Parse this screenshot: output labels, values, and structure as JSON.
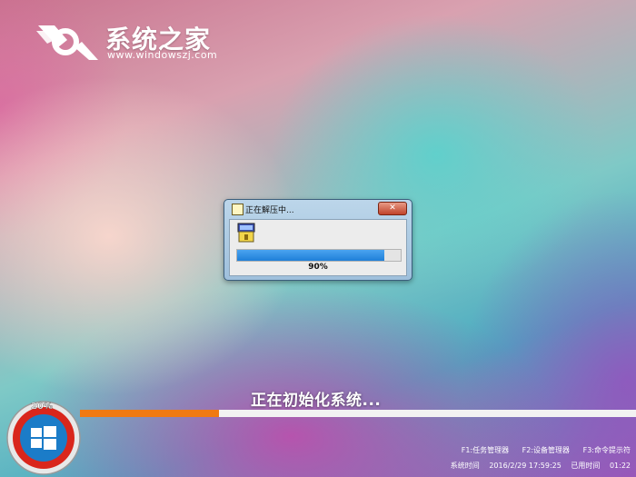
{
  "brand": {
    "title": "系统之家",
    "url": "www.windowszj.com"
  },
  "dialog": {
    "title": "正在解压中...",
    "close_label": "✕",
    "progress_percent": 90,
    "progress_label": "90%"
  },
  "status": {
    "text": "正在初始化系统..."
  },
  "installer": {
    "overall_percent": 20,
    "overall_label": "20%",
    "overall_bar_fraction": 0.25
  },
  "footer": {
    "f1": "F1:任务管理器",
    "f2": "F2:设备管理器",
    "f3": "F3:命令提示符",
    "system_time_label": "系统时间",
    "system_time": "2016/2/29 17:59:25",
    "elapsed_label": "已用时间",
    "elapsed": "01:22"
  },
  "colors": {
    "accent_orange": "#f07a12",
    "progress_blue": "#1f7fd8",
    "badge_red": "#d9261c",
    "windows_blue": "#1fa3e8"
  },
  "icons": {
    "brand_mark": "windowszj-logo-icon",
    "app": "extractor-app-icon",
    "windows": "windows-logo-icon"
  }
}
